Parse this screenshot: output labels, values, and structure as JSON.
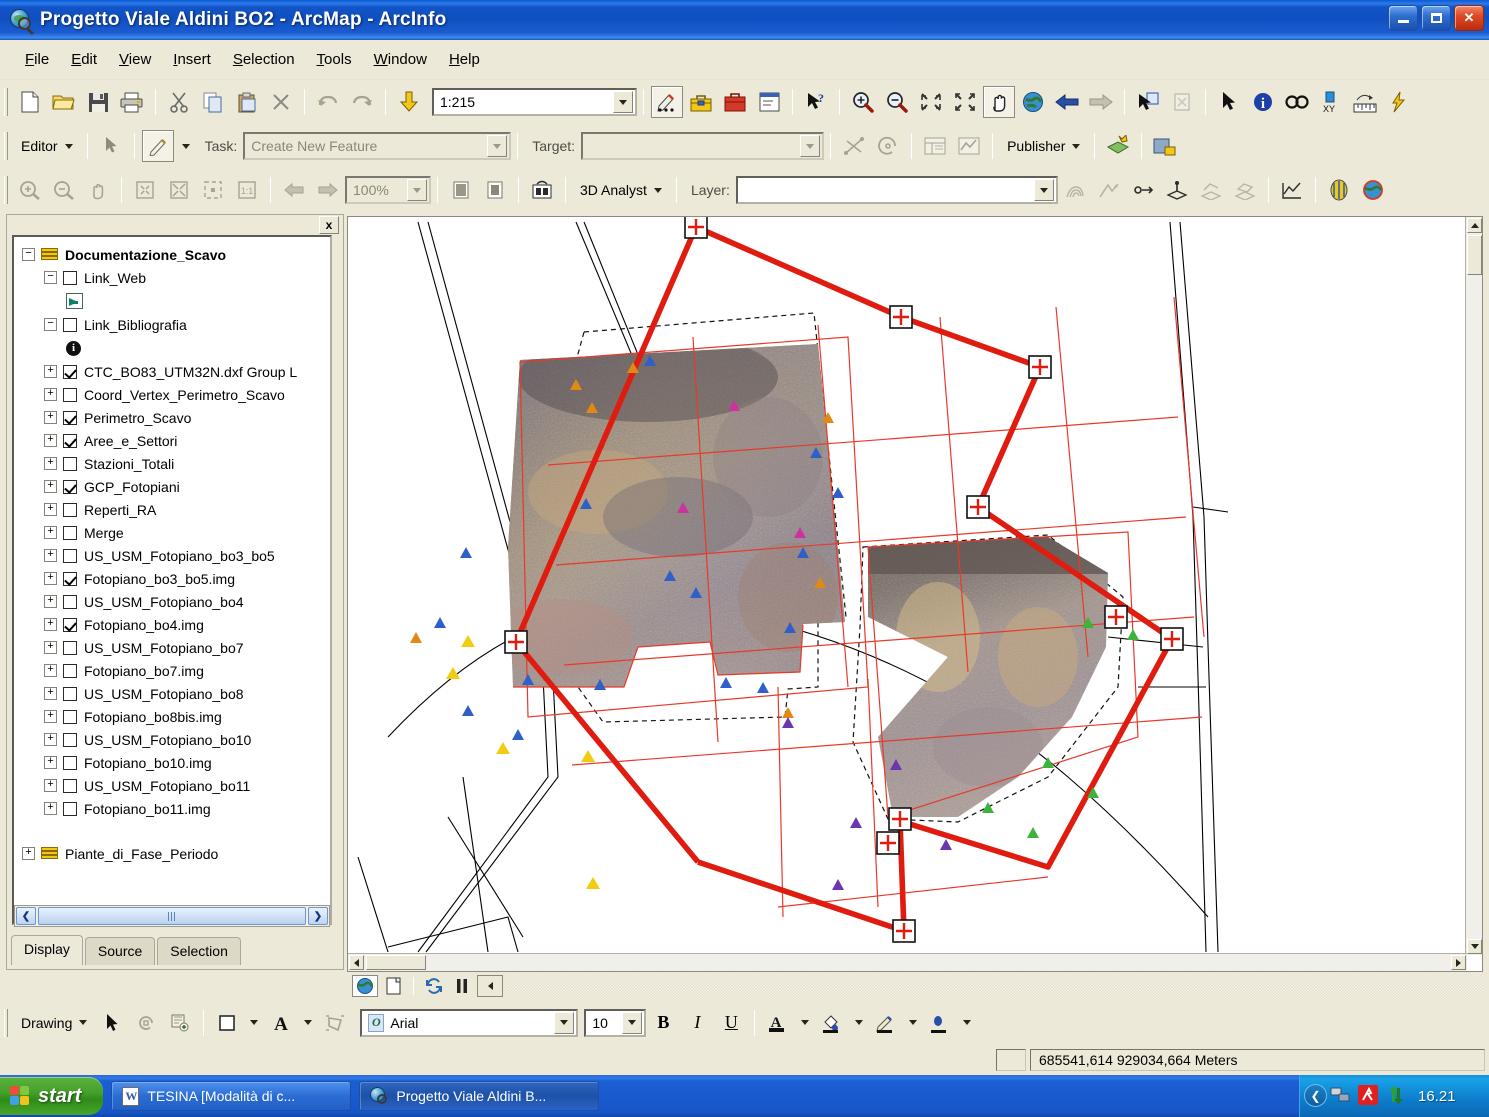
{
  "window": {
    "title": "Progetto Viale Aldini BO2 - ArcMap - ArcInfo",
    "app_icon": "arcmap-globe-icon",
    "minimize_label": "",
    "maximize_label": "",
    "close_label": "×"
  },
  "menu": {
    "items": [
      "File",
      "Edit",
      "View",
      "Insert",
      "Selection",
      "Tools",
      "Window",
      "Help"
    ]
  },
  "standard_toolbar": {
    "buttons": [
      "new-document-icon",
      "open-folder-icon",
      "save-icon",
      "print-icon",
      "cut-icon",
      "copy-icon",
      "paste-icon",
      "delete-icon",
      "undo-icon",
      "redo-icon",
      "add-data-icon"
    ],
    "scale_label": "1:215",
    "after_scale": [
      "editor-toolbar-icon",
      "arctoolbox-icon",
      "show-hide-toc-icon",
      "command-line-icon",
      "whats-this-help-icon"
    ]
  },
  "tools_toolbar": {
    "buttons": [
      "zoom-in-icon",
      "zoom-out-icon",
      "fixed-zoom-in-icon",
      "fixed-zoom-out-icon",
      "pan-icon",
      "full-extent-icon",
      "back-extent-icon",
      "forward-extent-icon",
      "select-features-icon",
      "clear-selected-icon",
      "select-elements-icon",
      "identify-icon",
      "find-icon",
      "go-to-xy-icon",
      "measure-icon",
      "hyperlink-icon"
    ]
  },
  "editor_toolbar": {
    "editor_menu": "Editor",
    "task_label": "Task:",
    "task_value": "Create New Feature",
    "target_label": "Target:",
    "target_value": "",
    "publisher_menu": "Publisher"
  },
  "layout_toolbar": {
    "zoom_value": "100%",
    "analyst_menu": "3D Analyst",
    "layer_label": "Layer:",
    "layer_value": ""
  },
  "toc": {
    "close_label": "x",
    "tabs": [
      {
        "label": "Display",
        "active": true
      },
      {
        "label": "Source",
        "active": false
      },
      {
        "label": "Selection",
        "active": false
      }
    ],
    "data_frame": {
      "label": "Documentazione_Scavo",
      "expander": "−",
      "icon": "layers-icon"
    },
    "layers": [
      {
        "label": "Link_Web",
        "expander": "−",
        "checked": false,
        "symbol": "green-arrow-symbol"
      },
      {
        "label": "Link_Bibliografia",
        "expander": "−",
        "checked": false,
        "symbol": "info-symbol"
      },
      {
        "label": "CTC_BO83_UTM32N.dxf Group L",
        "expander": "+",
        "checked": true,
        "symbol": null
      },
      {
        "label": "Coord_Vertex_Perimetro_Scavo",
        "expander": "+",
        "checked": false,
        "symbol": null
      },
      {
        "label": "Perimetro_Scavo",
        "expander": "+",
        "checked": true,
        "symbol": null
      },
      {
        "label": "Aree_e_Settori",
        "expander": "+",
        "checked": true,
        "symbol": null
      },
      {
        "label": "Stazioni_Totali",
        "expander": "+",
        "checked": false,
        "symbol": null
      },
      {
        "label": "GCP_Fotopiani",
        "expander": "+",
        "checked": true,
        "symbol": null
      },
      {
        "label": "Reperti_RA",
        "expander": "+",
        "checked": false,
        "symbol": null
      },
      {
        "label": "Merge",
        "expander": "+",
        "checked": false,
        "symbol": null
      },
      {
        "label": "US_USM_Fotopiano_bo3_bo5",
        "expander": "+",
        "checked": false,
        "symbol": null
      },
      {
        "label": "Fotopiano_bo3_bo5.img",
        "expander": "+",
        "checked": true,
        "symbol": null
      },
      {
        "label": "US_USM_Fotopiano_bo4",
        "expander": "+",
        "checked": false,
        "symbol": null
      },
      {
        "label": "Fotopiano_bo4.img",
        "expander": "+",
        "checked": true,
        "symbol": null
      },
      {
        "label": "US_USM_Fotopiano_bo7",
        "expander": "+",
        "checked": false,
        "symbol": null
      },
      {
        "label": "Fotopiano_bo7.img",
        "expander": "+",
        "checked": false,
        "symbol": null
      },
      {
        "label": "US_USM_Fotopiano_bo8",
        "expander": "+",
        "checked": false,
        "symbol": null
      },
      {
        "label": "Fotopiano_bo8bis.img",
        "expander": "+",
        "checked": false,
        "symbol": null
      },
      {
        "label": "US_USM_Fotopiano_bo10",
        "expander": "+",
        "checked": false,
        "symbol": null
      },
      {
        "label": "Fotopiano_bo10.img",
        "expander": "+",
        "checked": false,
        "symbol": null
      },
      {
        "label": "US_USM_Fotopiano_bo11",
        "expander": "+",
        "checked": false,
        "symbol": null
      },
      {
        "label": "Fotopiano_bo11.img",
        "expander": "+",
        "checked": false,
        "symbol": null
      }
    ],
    "second_data_frame": {
      "label": "Piante_di_Fase_Periodo",
      "expander": "+",
      "icon": "layers-icon"
    }
  },
  "map": {
    "view_buttons": [
      "data-view-icon",
      "layout-view-icon",
      "refresh-view-icon",
      "pause-drawing-icon",
      "collapse-icon"
    ],
    "colors": {
      "perimeter": "#e01b0f",
      "sector_grid": "#e8392a",
      "cadastral": "#000000",
      "gcp_blue": "#2f5fc8",
      "gcp_orange": "#e08a14",
      "gcp_yellow": "#f2cc10",
      "gcp_magenta": "#cc33a0",
      "gcp_purple": "#6b36b0",
      "gcp_green": "#3cb43c"
    }
  },
  "drawing_toolbar": {
    "menu_label": "Drawing",
    "font_name": "Arial",
    "font_size": "10",
    "bold": "B",
    "italic": "I",
    "underline": "U",
    "buttons": [
      "select-elements-icon",
      "rotate-icon",
      "new-graphic-icon",
      "fill-color-icon",
      "text-tool-icon",
      "nudge-icon",
      "font-color-icon",
      "fill-symbol-icon",
      "line-symbol-icon",
      "marker-symbol-icon"
    ]
  },
  "status_bar": {
    "coordinates": "685541,614  929034,664 Meters"
  },
  "taskbar": {
    "start_label": "start",
    "items": [
      {
        "label": "TESINA [Modalità di c...",
        "icon": "word-document-icon",
        "active": false
      },
      {
        "label": "Progetto Viale Aldini B...",
        "icon": "arcmap-globe-icon",
        "active": true
      }
    ],
    "tray": {
      "expand_label": "❮",
      "icons": [
        "network-icon",
        "antivirus-icon",
        "network-activity-icon"
      ],
      "clock": "16.21"
    }
  }
}
